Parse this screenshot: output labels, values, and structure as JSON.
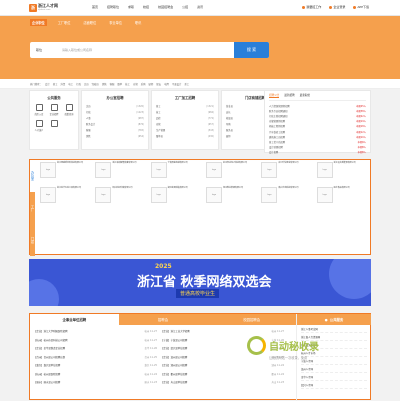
{
  "logo": {
    "mark": "浙",
    "title": "浙江人才网",
    "subtitle": "zjtalent.com"
  },
  "topnav": [
    "首页",
    "招聘职位",
    "求职",
    "校招",
    "校园招聘会",
    "公招",
    "资讯"
  ],
  "topright": [
    "我要招工作",
    "企业登录",
    "APP下载"
  ],
  "category_tabs": [
    "企业职位",
    "工厂职位",
    "店面职位",
    "事业单位",
    "职讯"
  ],
  "search": {
    "select": "职位",
    "placeholder": "请输入职位或公司名称",
    "button": "搜 索"
  },
  "hot_keywords": [
    "热门搜索：",
    "会计",
    "普工",
    "外贸",
    "电工",
    "行政",
    "文员",
    "驾驶员",
    "销售",
    "客服",
    "跟单",
    "技工",
    "仓管",
    "采购",
    "厨师",
    "保安",
    "电焊",
    "平面设计",
    "美工"
  ],
  "public_service": {
    "title": "公共服务",
    "items": [
      {
        "label": "简历入库",
        "icon": "resume-icon"
      },
      {
        "label": "企业招聘",
        "icon": "company-icon"
      },
      {
        "label": "政策咨询",
        "icon": "policy-icon"
      },
      {
        "label": "人才落户",
        "icon": "household-icon"
      },
      {
        "label": "",
        "icon": "person-icon"
      }
    ]
  },
  "columns": [
    {
      "title": "办公室招聘",
      "rows": [
        [
          "文员",
          "(1320)"
        ],
        [
          "行政",
          "(1223)"
        ],
        [
          "人事",
          "(987)"
        ],
        [
          "财务会计",
          "(876)"
        ],
        [
          "客服",
          "(765)"
        ],
        [
          "销售",
          "(654)"
        ]
      ]
    },
    {
      "title": "工厂加工招聘",
      "rows": [
        [
          "普工",
          "(1321)"
        ],
        [
          "技工",
          "(984)"
        ],
        [
          "品检",
          "(772)"
        ],
        [
          "仓管",
          "(657)"
        ],
        [
          "生产管理",
          "(543)"
        ],
        [
          "跟单员",
          "(430)"
        ]
      ]
    },
    {
      "title": "门店商铺招聘",
      "rows": [
        [
          "营业员",
          "(1120)"
        ],
        [
          "店长",
          "(878)"
        ],
        [
          "收银员",
          "(760)"
        ],
        [
          "导购",
          "(647)"
        ],
        [
          "服务员",
          "(533)"
        ],
        [
          "厨师",
          "(418)"
        ]
      ]
    }
  ],
  "right_panel": {
    "tabs": [
      "招聘公告",
      "最新招聘",
      "最新职位"
    ],
    "rows": [
      [
        "人力资源管理师招聘",
        "本期45人"
      ],
      [
        "财务专员招聘通知",
        "本期38人"
      ],
      [
        "行政主管招聘通知",
        "本期22人"
      ],
      [
        "仓储管理师招聘",
        "本期19人"
      ],
      [
        "机械工程师招聘",
        "本期18人"
      ],
      [
        "汽车维修工招聘",
        "本期12人"
      ],
      [
        "建筑施工员招聘",
        "本期10人"
      ],
      [
        "普工若干名招聘",
        "本期9人"
      ],
      [
        "设计助理招聘",
        "本期8人"
      ],
      [
        "会计招聘",
        "本期8人"
      ]
    ]
  },
  "company_side_tabs": [
    "办公室",
    "工厂",
    "门店"
  ],
  "companies": [
    [
      "logo",
      "浙江明盛新材料科技有限公司"
    ],
    [
      "logo",
      "浙江海润智能装备有限公司"
    ],
    [
      "logo",
      "宁波鼎盛机械有限公司"
    ],
    [
      "logo",
      "杭州恒达电子科技有限公司"
    ],
    [
      "logo",
      "台州华信塑业有限公司"
    ],
    [
      "logo",
      "浙江远大新能源有限公司"
    ],
    [
      "logo",
      "浙江金华五金工具有限公司"
    ],
    [
      "logo",
      "绍兴纺织印染有限公司"
    ],
    [
      "logo",
      "湖州家具制造有限公司"
    ],
    [
      "logo",
      "温州鞋业集团有限公司"
    ],
    [
      "logo",
      "嘉兴光电科技有限公司"
    ],
    [
      "logo",
      "丽水食品有限公司"
    ]
  ],
  "banner": {
    "year": "2025",
    "title": "浙江省 秋季网络双选会",
    "subtitle": "普通高校毕业生"
  },
  "bottom_tabs": [
    "企事业单位招聘",
    "招聘会",
    "校园招聘会"
  ],
  "jobs": [
    [
      "【企业】浙江大学附属医院招聘",
      "杭州 11-27"
    ],
    [
      "【企业】浙江工业大学招聘",
      "杭州 11-27"
    ],
    [
      "【杭州】杭州市某科技公司招聘",
      "杭州 11-27"
    ],
    [
      "【宁波】宁波某公司招聘",
      "宁波 11-26"
    ],
    [
      "【企业】金华某制造企业招聘",
      "金华 11-26"
    ],
    [
      "【企业】绍兴某单位招聘",
      "绍兴 11-26"
    ],
    [
      "【台州】台州某公司招聘启事",
      "台州 11-25"
    ],
    [
      "【企业】温州某公司招聘",
      "温州 11-25"
    ],
    [
      "【嘉兴】嘉兴某单位招聘",
      "嘉兴 11-25"
    ],
    [
      "【企业】湖州某公司招聘",
      "湖州 11-24"
    ],
    [
      "【杭州】杭州某医院招聘",
      "杭州 11-24"
    ],
    [
      "【企业】衢州某单位招聘",
      "衢州 11-24"
    ],
    [
      "【丽水】丽水某公司招聘",
      "丽水 11-23"
    ],
    [
      "【企业】舟山某单位招聘",
      "舟山 11-23"
    ]
  ],
  "public_service_box": {
    "title": "公共服务",
    "lines": [
      "浙江人事考试网",
      "浙江省人力资源网",
      "浙江政务服务网",
      "杭州人才市场",
      "宁波人才网",
      "温州人才网",
      "金华人才网",
      "绍兴人才网"
    ]
  },
  "watermark": {
    "brand": "自动秘收录",
    "sub": "让优质网站一次收录，免费"
  },
  "colors": {
    "accent": "#f07a26",
    "orange_band": "#f5a04d",
    "blue": "#2a7fd9",
    "banner": "#3a56d4"
  }
}
